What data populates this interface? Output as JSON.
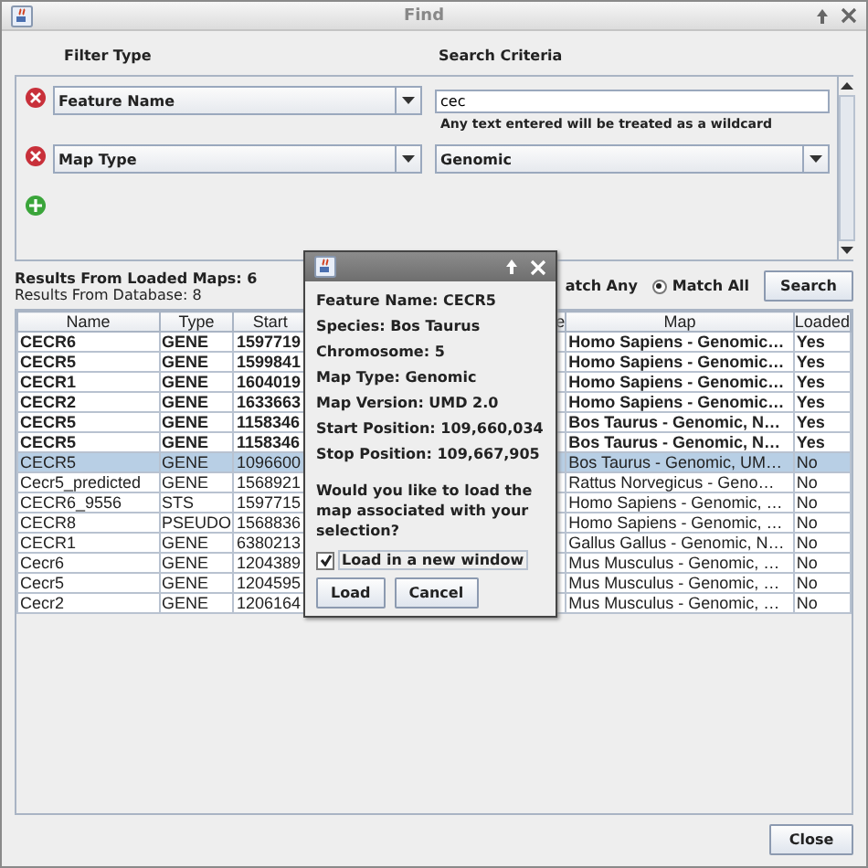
{
  "window": {
    "title": "Find"
  },
  "filter_headers": [
    "Filter Type",
    "Search Criteria"
  ],
  "filters": [
    {
      "kind": "text",
      "filter_type": "Feature Name",
      "value": "cec",
      "hint": "Any text entered will be treated as a wildcard"
    },
    {
      "kind": "select",
      "filter_type": "Map Type",
      "value": "Genomic"
    }
  ],
  "results": {
    "loaded_maps": "Results From Loaded Maps: 6",
    "database": "Results From Database: 8"
  },
  "match_any": {
    "label": "atch Any"
  },
  "match_all": {
    "label": "Match All",
    "selected": true
  },
  "search_button": "Search",
  "table": {
    "columns": [
      "Name",
      "Type",
      "Start",
      "e",
      "Map",
      "Loaded"
    ],
    "rows": [
      {
        "cells": [
          "CECR6",
          "GENE",
          "1597719",
          "",
          "Homo Sapiens - Genomic…",
          "Yes"
        ],
        "in_loaded_map": true,
        "selected": false
      },
      {
        "cells": [
          "CECR5",
          "GENE",
          "1599841",
          "",
          "Homo Sapiens - Genomic…",
          "Yes"
        ],
        "in_loaded_map": true,
        "selected": false
      },
      {
        "cells": [
          "CECR1",
          "GENE",
          "1604019",
          "",
          "Homo Sapiens - Genomic…",
          "Yes"
        ],
        "in_loaded_map": true,
        "selected": false
      },
      {
        "cells": [
          "CECR2",
          "GENE",
          "1633663",
          "",
          "Homo Sapiens - Genomic…",
          "Yes"
        ],
        "in_loaded_map": true,
        "selected": false
      },
      {
        "cells": [
          "CECR5",
          "GENE",
          "1158346",
          "",
          "Bos Taurus - Genomic, N…",
          "Yes"
        ],
        "in_loaded_map": true,
        "selected": false
      },
      {
        "cells": [
          "CECR5",
          "GENE",
          "1158346",
          "",
          "Bos Taurus - Genomic, N…",
          "Yes"
        ],
        "in_loaded_map": true,
        "selected": false
      },
      {
        "cells": [
          "CECR5",
          "GENE",
          "1096600",
          "",
          "Bos Taurus - Genomic, UM…",
          "No"
        ],
        "in_loaded_map": false,
        "selected": true
      },
      {
        "cells": [
          "Cecr5_predicted",
          "GENE",
          "1568921",
          "",
          "Rattus Norvegicus - Geno…",
          "No"
        ],
        "in_loaded_map": false,
        "selected": false
      },
      {
        "cells": [
          "CECR6_9556",
          "STS",
          "1597715",
          "",
          "Homo Sapiens - Genomic, …",
          "No"
        ],
        "in_loaded_map": false,
        "selected": false
      },
      {
        "cells": [
          "CECR8",
          "PSEUDO",
          "1568836",
          "",
          "Homo Sapiens - Genomic, …",
          "No"
        ],
        "in_loaded_map": false,
        "selected": false
      },
      {
        "cells": [
          "CECR1",
          "GENE",
          "6380213",
          "",
          "Gallus Gallus - Genomic, N…",
          "No"
        ],
        "in_loaded_map": false,
        "selected": false
      },
      {
        "cells": [
          "Cecr6",
          "GENE",
          "1204389",
          "",
          "Mus Musculus - Genomic, …",
          "No"
        ],
        "in_loaded_map": false,
        "selected": false
      },
      {
        "cells": [
          "Cecr5",
          "GENE",
          "1204595",
          "",
          "Mus Musculus - Genomic, …",
          "No"
        ],
        "in_loaded_map": false,
        "selected": false
      },
      {
        "cells": [
          "Cecr2",
          "GENE",
          "1206164",
          "",
          "Mus Musculus - Genomic, …",
          "No"
        ],
        "in_loaded_map": false,
        "selected": false
      }
    ]
  },
  "dialog": {
    "details": [
      "Feature Name: CECR5",
      "Species: Bos Taurus",
      "Chromosome: 5",
      "Map Type: Genomic",
      "Map Version: UMD 2.0",
      "Start Position: 109,660,034",
      "Stop Position: 109,667,905"
    ],
    "question": "Would you like to load the map associated with your selection?",
    "checkbox": {
      "label": "Load in a new window",
      "checked": true
    },
    "buttons": [
      "Load",
      "Cancel"
    ]
  },
  "close_button": "Close"
}
